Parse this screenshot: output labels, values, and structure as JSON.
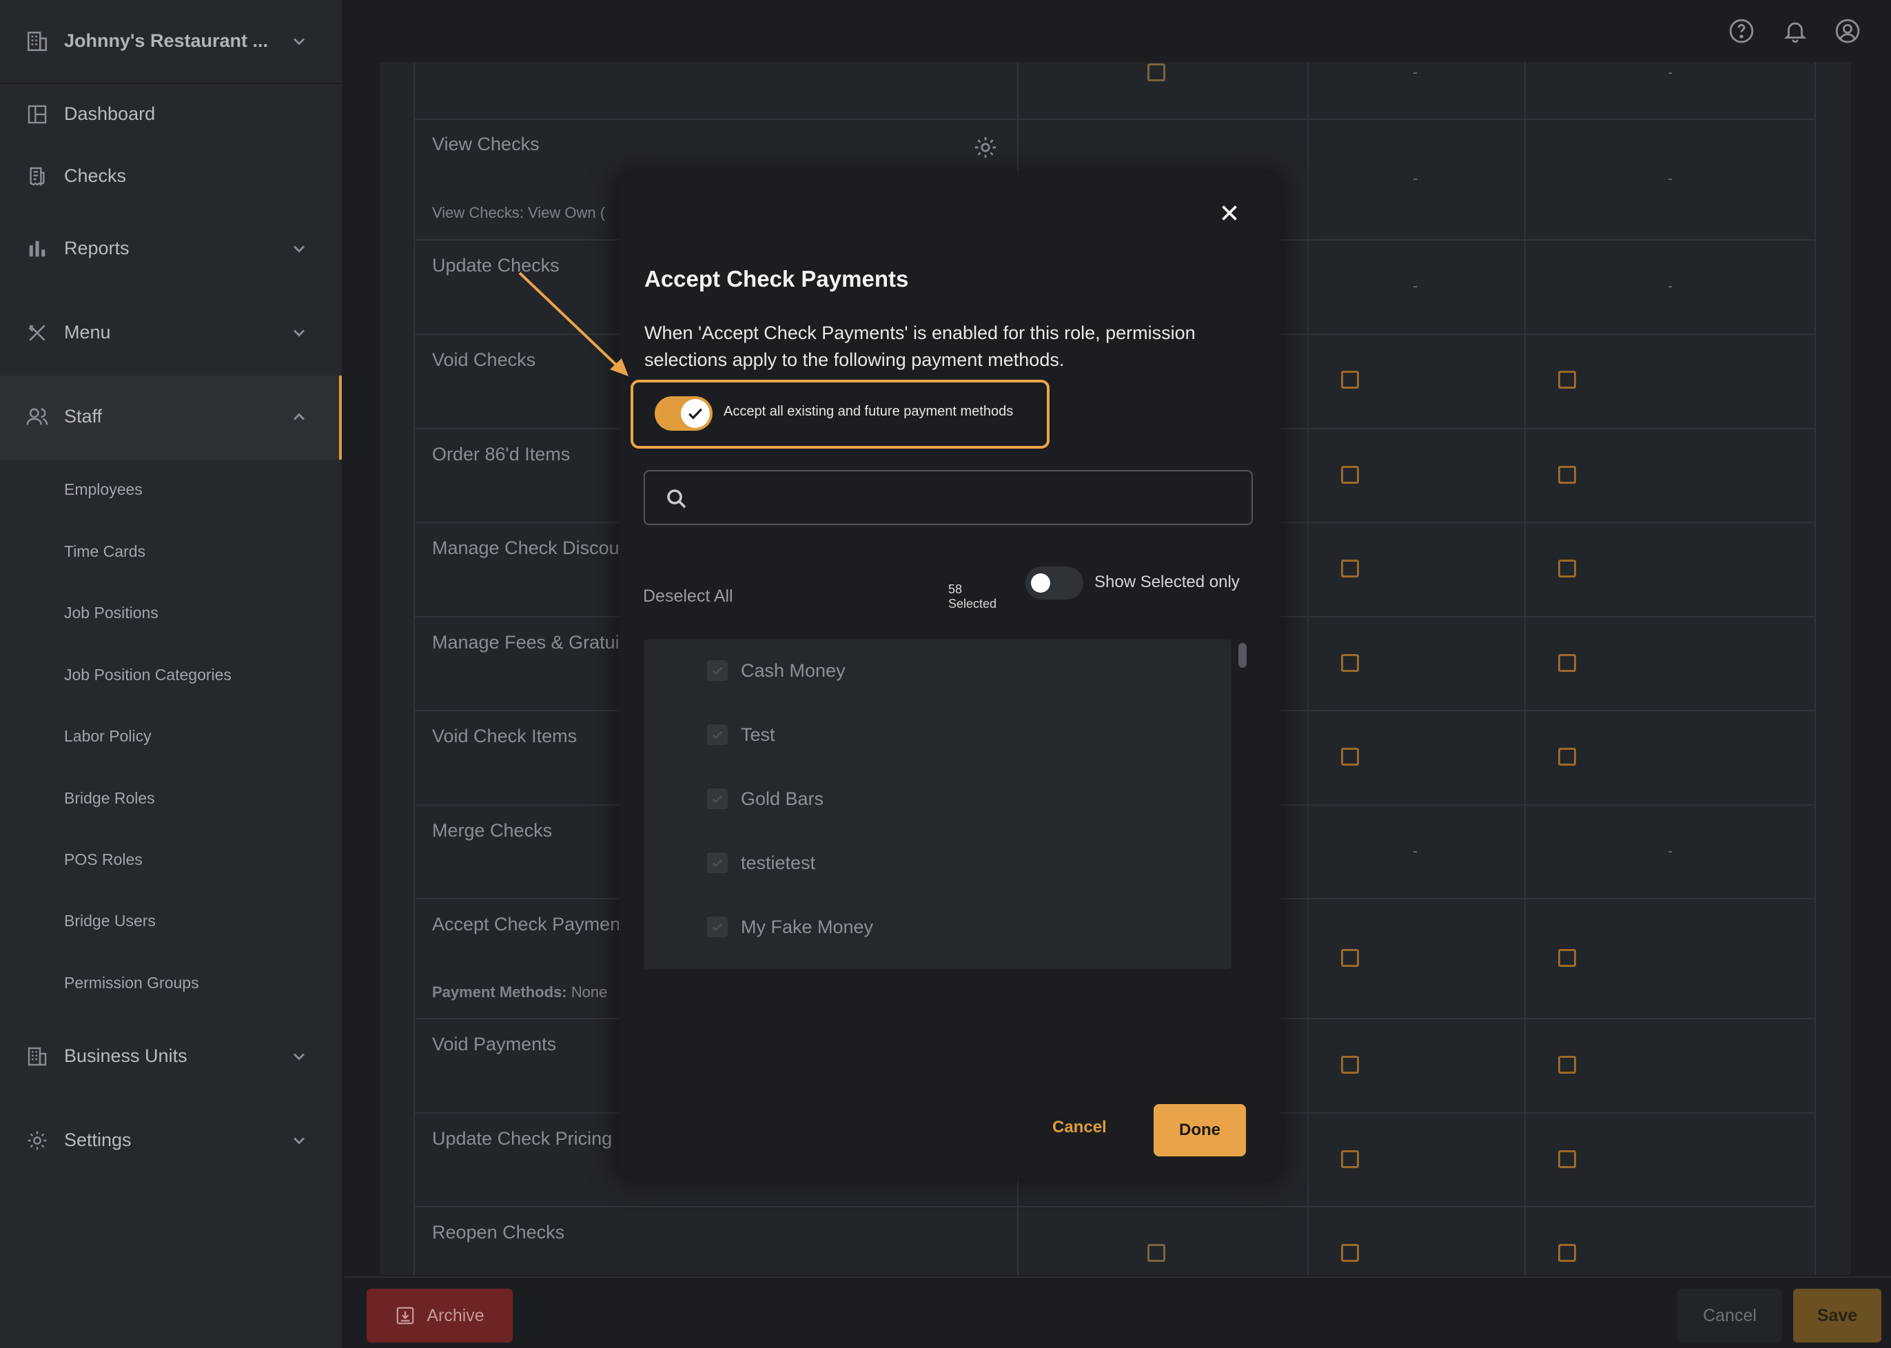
{
  "org": {
    "name": "Johnny's Restaurant ..."
  },
  "sidebar": {
    "items": [
      {
        "label": "Dashboard"
      },
      {
        "label": "Checks"
      },
      {
        "label": "Reports"
      },
      {
        "label": "Menu"
      },
      {
        "label": "Staff"
      },
      {
        "label": "Business Units"
      },
      {
        "label": "Settings"
      }
    ],
    "staff_sub": [
      "Employees",
      "Time Cards",
      "Job Positions",
      "Job Position Categories",
      "Labor Policy",
      "Bridge Roles",
      "POS Roles",
      "Bridge Users",
      "Permission Groups"
    ]
  },
  "table": {
    "rows": [
      {
        "label": "View Checks",
        "sub": "View Checks: View Own ("
      },
      {
        "label": "Update Checks"
      },
      {
        "label": "Void Checks"
      },
      {
        "label": "Order 86'd Items"
      },
      {
        "label": "Manage Check Discou"
      },
      {
        "label": "Manage Fees & Gratuit"
      },
      {
        "label": "Void Check Items"
      },
      {
        "label": "Merge Checks"
      },
      {
        "label": "Accept Check Paymen",
        "sub_bold": "Payment Methods:",
        "sub_value": " None"
      },
      {
        "label": "Void Payments"
      },
      {
        "label": "Update Check Pricing"
      },
      {
        "label": "Reopen Checks"
      }
    ],
    "dash": "-"
  },
  "footer": {
    "archive_label": "Archive",
    "cancel_label": "Cancel",
    "save_label": "Save"
  },
  "modal": {
    "title": "Accept Check Payments",
    "description": "When 'Accept Check Payments' is enabled for this role, permission selections apply to the following payment methods.",
    "accept_all_label": "Accept all existing and future payment methods",
    "search_placeholder": "",
    "deselect_all": "Deselect All",
    "selected_count": "58",
    "selected_word": "Selected",
    "show_selected_label": "Show Selected only",
    "items": [
      "Cash Money",
      "Test",
      "Gold Bars",
      "testietest",
      "My Fake Money"
    ],
    "cancel_label": "Cancel",
    "done_label": "Done"
  },
  "colors": {
    "accent": "#e09c3c",
    "archive": "#6e2424"
  }
}
